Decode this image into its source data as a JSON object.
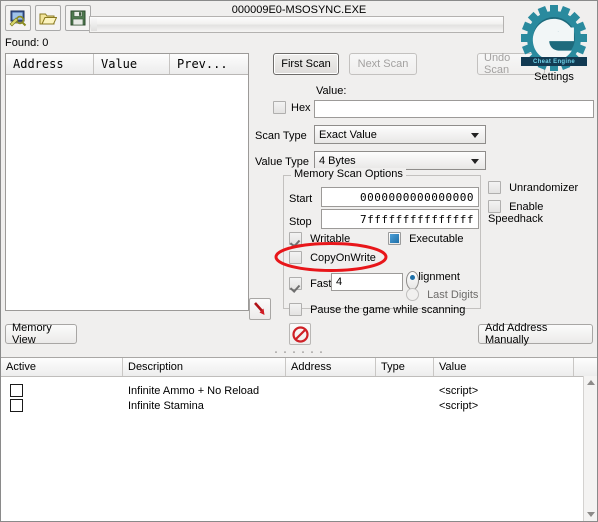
{
  "window": {
    "title": "000009E0-MSOSYNC.EXE"
  },
  "toolbar": {
    "open_process_icon": "process-select-icon",
    "open_file_icon": "open-folder-icon",
    "save_file_icon": "save-floppy-icon"
  },
  "status": {
    "found_label": "Found: 0"
  },
  "results": {
    "columns": [
      "Address",
      "Value",
      "Prev..."
    ],
    "rows": []
  },
  "scan_buttons": {
    "first_scan": "First Scan",
    "next_scan": "Next Scan",
    "undo_scan": "Undo Scan"
  },
  "branding": {
    "logo_alt": "cheat-engine-logo",
    "logo_banner": "Cheat Engine",
    "settings_label": "Settings",
    "logo_color": "#2a8a9e"
  },
  "scan_form": {
    "value_label": "Value:",
    "hex_label": "Hex",
    "hex_checked": false,
    "value_input": "",
    "scan_type_label": "Scan Type",
    "scan_type_value": "Exact Value",
    "value_type_label": "Value Type",
    "value_type_value": "4 Bytes"
  },
  "memory_scan_options": {
    "group_title": "Memory Scan Options",
    "start_label": "Start",
    "start_value": "0000000000000000",
    "stop_label": "Stop",
    "stop_value": "7fffffffffffffff",
    "writable_label": "Writable",
    "writable_checked": true,
    "executable_label": "Executable",
    "executable_state": "indeterminate",
    "copyonwrite_label": "CopyOnWrite",
    "copyonwrite_checked": false,
    "fast_scan_label": "Fast Scan",
    "fast_scan_checked": true,
    "fast_scan_value": "4",
    "alignment_label": "Alignment",
    "alignment_selected": true,
    "last_digits_label": "Last Digits",
    "last_digits_selected": false,
    "pause_label": "Pause the game while scanning",
    "pause_checked": false
  },
  "side_options": {
    "unrandomizer_label": "Unrandomizer",
    "unrandomizer_checked": false,
    "speedhack_label": "Enable Speedhack",
    "speedhack_checked": false
  },
  "bottom_buttons": {
    "memory_view": "Memory View",
    "stop_icon": "stop-prohibition-icon",
    "add_address": "Add Address Manually",
    "pointer_icon": "red-arrow-pointer-icon"
  },
  "annotation": {
    "shape": "ellipse",
    "color": "#e8161a",
    "target": "CopyOnWrite"
  },
  "cheat_table": {
    "columns": [
      "Active",
      "Description",
      "Address",
      "Type",
      "Value"
    ],
    "rows": [
      {
        "active": false,
        "description": "Infinite Ammo + No Reload",
        "address": "",
        "type": "",
        "value": "<script>"
      },
      {
        "active": false,
        "description": "Infinite Stamina",
        "address": "",
        "type": "",
        "value": "<script>"
      }
    ]
  }
}
